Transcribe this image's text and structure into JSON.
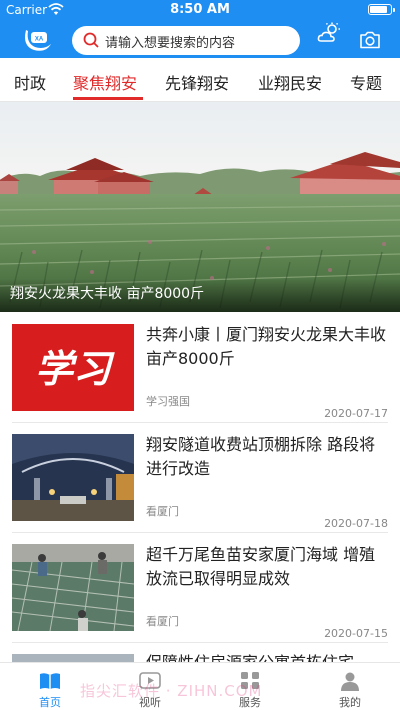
{
  "status_bar": {
    "carrier": "Carrier",
    "time": "8:50 AM"
  },
  "header": {
    "search_placeholder": "请输入想要搜索的内容",
    "icons": [
      "app-logo",
      "search-icon",
      "weather-icon",
      "camera-icon"
    ],
    "brand_color": "#1e8ef3"
  },
  "tabs": {
    "items": [
      {
        "label": "时政"
      },
      {
        "label": "聚焦翔安"
      },
      {
        "label": "先锋翔安"
      },
      {
        "label": "业翔民安"
      },
      {
        "label": "专题"
      }
    ],
    "active_color": "#e12b2b"
  },
  "hero": {
    "caption": "翔安火龙果大丰收 亩产8000斤"
  },
  "news": [
    {
      "title": "共奔小康丨厦门翔安火龙果大丰收 亩产8000斤",
      "source": "学习强国",
      "date": "2020-07-17",
      "thumb_text": "学习"
    },
    {
      "title": "翔安隧道收费站顶棚拆除 路段将进行改造",
      "source": "看厦门",
      "date": "2020-07-18"
    },
    {
      "title": "超千万尾鱼苗安家厦门海域 增殖放流已取得明显成效",
      "source": "看厦门",
      "date": "2020-07-15"
    },
    {
      "title": "保障性住房源家公寓首栋住宅"
    }
  ],
  "bottom_nav": {
    "items": [
      {
        "label": "首页",
        "icon": "book-icon"
      },
      {
        "label": "视听",
        "icon": "video-icon"
      },
      {
        "label": "服务",
        "icon": "services-icon"
      },
      {
        "label": "我的",
        "icon": "profile-icon"
      }
    ],
    "active_index": 0
  },
  "watermark": "指尖汇软件 · ZIHN.COM"
}
